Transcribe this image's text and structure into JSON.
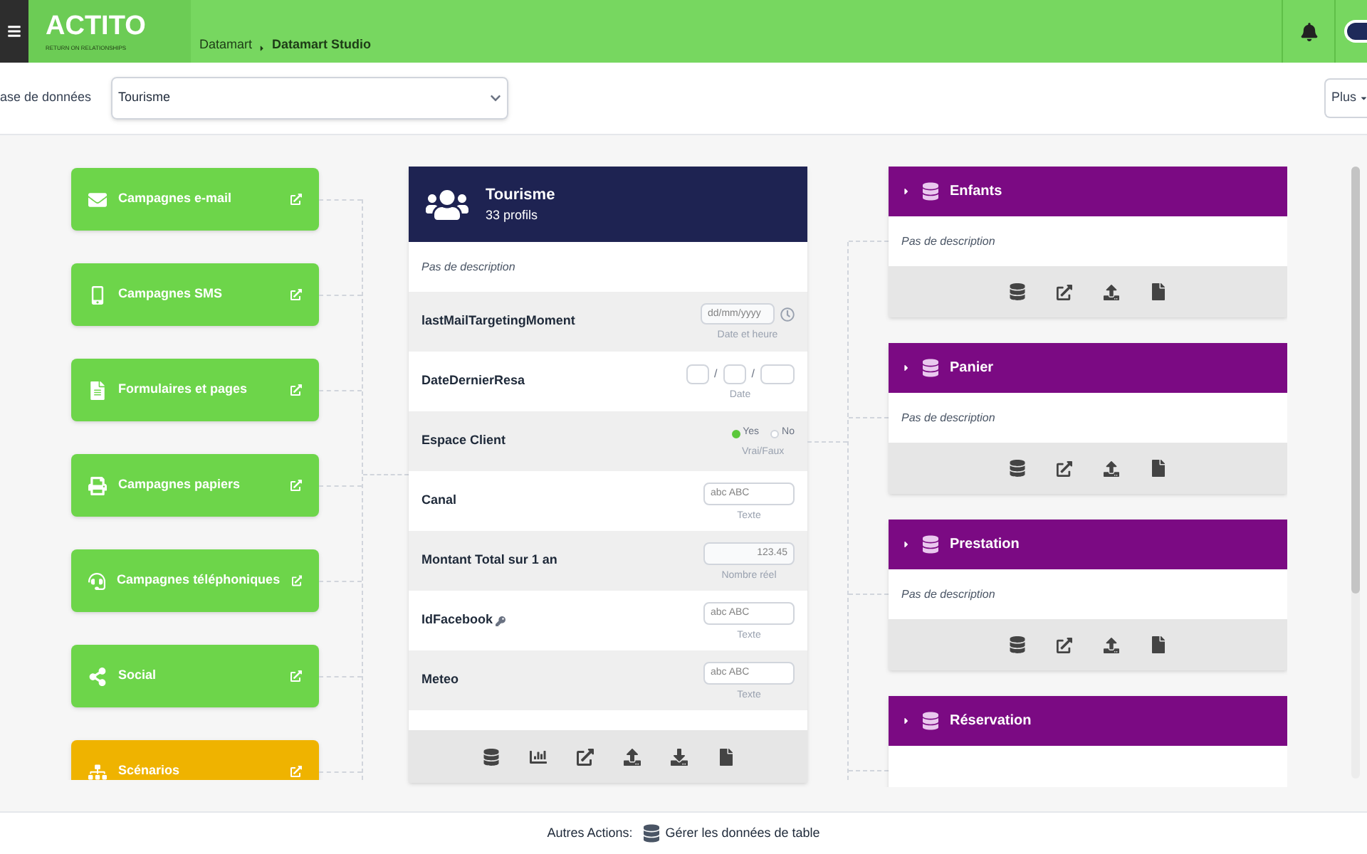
{
  "header": {
    "logo": "ACTITO",
    "tagline": "RETURN ON RELATIONSHIPS",
    "breadcrumb": [
      {
        "label": "Datamart",
        "current": false
      },
      {
        "label": "Datamart Studio",
        "current": true
      }
    ]
  },
  "filter": {
    "label": "ase de données",
    "value": "Tourisme",
    "more_button": "Plus"
  },
  "channels": [
    {
      "label": "Campagnes e-mail",
      "color": "#6dd54a"
    },
    {
      "label": "Campagnes SMS",
      "color": "#6dd54a"
    },
    {
      "label": "Formulaires et pages",
      "color": "#6dd54a"
    },
    {
      "label": "Campagnes papiers",
      "color": "#6dd54a"
    },
    {
      "label": "Campagnes téléphoniques",
      "color": "#6dd54a"
    },
    {
      "label": "Social",
      "color": "#6dd54a"
    },
    {
      "label": "Scénarios",
      "color": "#efb300"
    }
  ],
  "main_table": {
    "title": "Tourisme",
    "subtitle": "33 profils",
    "description": "Pas de description",
    "fields": [
      {
        "name": "lastMailTargetingMoment",
        "kind": "datetime",
        "key": false,
        "placeholder": "dd/mm/yyyy",
        "type_label": "Date et heure"
      },
      {
        "name": "DateDernierResa",
        "kind": "date",
        "key": false,
        "separators": [
          "/",
          "/"
        ],
        "type_label": "Date"
      },
      {
        "name": "Espace Client",
        "kind": "boolean",
        "key": false,
        "options": [
          {
            "label": "Yes",
            "selected": true
          },
          {
            "label": "No",
            "selected": false
          }
        ],
        "type_label": "Vrai/Faux"
      },
      {
        "name": "Canal",
        "kind": "text",
        "key": false,
        "placeholder": "abc ABC",
        "type_label": "Texte"
      },
      {
        "name": "Montant Total sur 1 an",
        "kind": "number",
        "key": false,
        "placeholder": "123.45",
        "type_label": "Nombre réel"
      },
      {
        "name": "IdFacebook",
        "kind": "text",
        "key": true,
        "placeholder": "abc ABC",
        "type_label": "Texte"
      },
      {
        "name": "Meteo",
        "kind": "text",
        "key": false,
        "placeholder": "abc ABC",
        "type_label": "Texte"
      }
    ]
  },
  "linked_tables": [
    {
      "title": "Enfants",
      "description": "Pas de description"
    },
    {
      "title": "Panier",
      "description": "Pas de description"
    },
    {
      "title": "Prestation",
      "description": "Pas de description"
    },
    {
      "title": "Réservation"
    }
  ],
  "footer": {
    "label": "Autres Actions:",
    "action": "Gérer les données de table"
  }
}
